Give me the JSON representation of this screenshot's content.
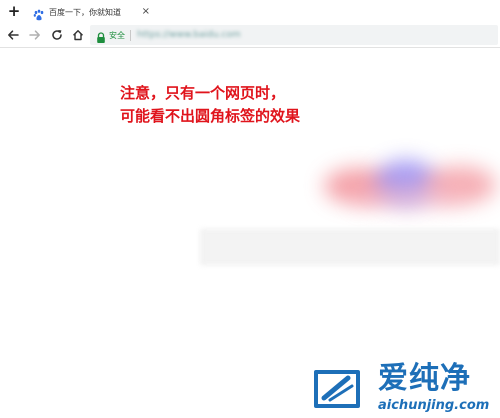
{
  "browser": {
    "new_tab_label": "+",
    "tab": {
      "title": "百度一下，你就知道",
      "close_label": "×",
      "favicon": "baidu-paw-icon"
    },
    "toolbar": {
      "back": "arrow-left-icon",
      "forward": "arrow-right-icon",
      "reload": "reload-icon",
      "home": "home-icon"
    },
    "omnibox": {
      "secure_label": "安全",
      "url": "https://www.baidu.com"
    }
  },
  "content": {
    "note_lines": [
      "注意，只有一个网页时，",
      "可能看不出圆角标签的效果"
    ]
  },
  "watermark": {
    "title": "爱纯净",
    "url": "aichunjing.com"
  },
  "colors": {
    "note_red": "#e0141c",
    "secure_green": "#1e8e3e",
    "watermark_blue": "#1d6fb8"
  }
}
